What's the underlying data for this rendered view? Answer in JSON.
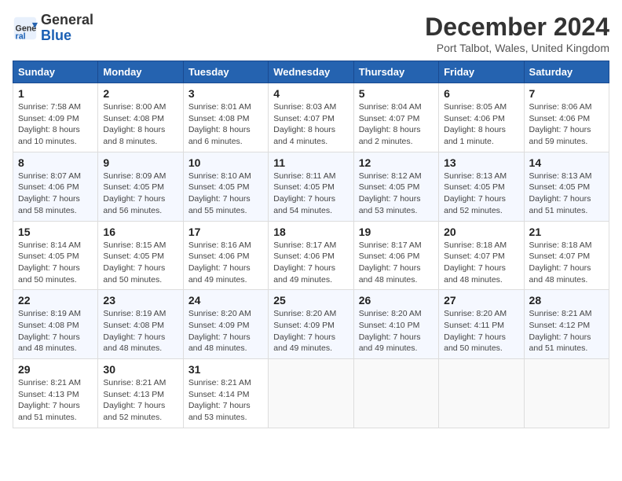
{
  "header": {
    "logo_line1": "General",
    "logo_line2": "Blue",
    "title": "December 2024",
    "location": "Port Talbot, Wales, United Kingdom"
  },
  "weekdays": [
    "Sunday",
    "Monday",
    "Tuesday",
    "Wednesday",
    "Thursday",
    "Friday",
    "Saturday"
  ],
  "weeks": [
    [
      {
        "day": "1",
        "sunrise": "Sunrise: 7:58 AM",
        "sunset": "Sunset: 4:09 PM",
        "daylight": "Daylight: 8 hours and 10 minutes."
      },
      {
        "day": "2",
        "sunrise": "Sunrise: 8:00 AM",
        "sunset": "Sunset: 4:08 PM",
        "daylight": "Daylight: 8 hours and 8 minutes."
      },
      {
        "day": "3",
        "sunrise": "Sunrise: 8:01 AM",
        "sunset": "Sunset: 4:08 PM",
        "daylight": "Daylight: 8 hours and 6 minutes."
      },
      {
        "day": "4",
        "sunrise": "Sunrise: 8:03 AM",
        "sunset": "Sunset: 4:07 PM",
        "daylight": "Daylight: 8 hours and 4 minutes."
      },
      {
        "day": "5",
        "sunrise": "Sunrise: 8:04 AM",
        "sunset": "Sunset: 4:07 PM",
        "daylight": "Daylight: 8 hours and 2 minutes."
      },
      {
        "day": "6",
        "sunrise": "Sunrise: 8:05 AM",
        "sunset": "Sunset: 4:06 PM",
        "daylight": "Daylight: 8 hours and 1 minute."
      },
      {
        "day": "7",
        "sunrise": "Sunrise: 8:06 AM",
        "sunset": "Sunset: 4:06 PM",
        "daylight": "Daylight: 7 hours and 59 minutes."
      }
    ],
    [
      {
        "day": "8",
        "sunrise": "Sunrise: 8:07 AM",
        "sunset": "Sunset: 4:06 PM",
        "daylight": "Daylight: 7 hours and 58 minutes."
      },
      {
        "day": "9",
        "sunrise": "Sunrise: 8:09 AM",
        "sunset": "Sunset: 4:05 PM",
        "daylight": "Daylight: 7 hours and 56 minutes."
      },
      {
        "day": "10",
        "sunrise": "Sunrise: 8:10 AM",
        "sunset": "Sunset: 4:05 PM",
        "daylight": "Daylight: 7 hours and 55 minutes."
      },
      {
        "day": "11",
        "sunrise": "Sunrise: 8:11 AM",
        "sunset": "Sunset: 4:05 PM",
        "daylight": "Daylight: 7 hours and 54 minutes."
      },
      {
        "day": "12",
        "sunrise": "Sunrise: 8:12 AM",
        "sunset": "Sunset: 4:05 PM",
        "daylight": "Daylight: 7 hours and 53 minutes."
      },
      {
        "day": "13",
        "sunrise": "Sunrise: 8:13 AM",
        "sunset": "Sunset: 4:05 PM",
        "daylight": "Daylight: 7 hours and 52 minutes."
      },
      {
        "day": "14",
        "sunrise": "Sunrise: 8:13 AM",
        "sunset": "Sunset: 4:05 PM",
        "daylight": "Daylight: 7 hours and 51 minutes."
      }
    ],
    [
      {
        "day": "15",
        "sunrise": "Sunrise: 8:14 AM",
        "sunset": "Sunset: 4:05 PM",
        "daylight": "Daylight: 7 hours and 50 minutes."
      },
      {
        "day": "16",
        "sunrise": "Sunrise: 8:15 AM",
        "sunset": "Sunset: 4:05 PM",
        "daylight": "Daylight: 7 hours and 50 minutes."
      },
      {
        "day": "17",
        "sunrise": "Sunrise: 8:16 AM",
        "sunset": "Sunset: 4:06 PM",
        "daylight": "Daylight: 7 hours and 49 minutes."
      },
      {
        "day": "18",
        "sunrise": "Sunrise: 8:17 AM",
        "sunset": "Sunset: 4:06 PM",
        "daylight": "Daylight: 7 hours and 49 minutes."
      },
      {
        "day": "19",
        "sunrise": "Sunrise: 8:17 AM",
        "sunset": "Sunset: 4:06 PM",
        "daylight": "Daylight: 7 hours and 48 minutes."
      },
      {
        "day": "20",
        "sunrise": "Sunrise: 8:18 AM",
        "sunset": "Sunset: 4:07 PM",
        "daylight": "Daylight: 7 hours and 48 minutes."
      },
      {
        "day": "21",
        "sunrise": "Sunrise: 8:18 AM",
        "sunset": "Sunset: 4:07 PM",
        "daylight": "Daylight: 7 hours and 48 minutes."
      }
    ],
    [
      {
        "day": "22",
        "sunrise": "Sunrise: 8:19 AM",
        "sunset": "Sunset: 4:08 PM",
        "daylight": "Daylight: 7 hours and 48 minutes."
      },
      {
        "day": "23",
        "sunrise": "Sunrise: 8:19 AM",
        "sunset": "Sunset: 4:08 PM",
        "daylight": "Daylight: 7 hours and 48 minutes."
      },
      {
        "day": "24",
        "sunrise": "Sunrise: 8:20 AM",
        "sunset": "Sunset: 4:09 PM",
        "daylight": "Daylight: 7 hours and 48 minutes."
      },
      {
        "day": "25",
        "sunrise": "Sunrise: 8:20 AM",
        "sunset": "Sunset: 4:09 PM",
        "daylight": "Daylight: 7 hours and 49 minutes."
      },
      {
        "day": "26",
        "sunrise": "Sunrise: 8:20 AM",
        "sunset": "Sunset: 4:10 PM",
        "daylight": "Daylight: 7 hours and 49 minutes."
      },
      {
        "day": "27",
        "sunrise": "Sunrise: 8:20 AM",
        "sunset": "Sunset: 4:11 PM",
        "daylight": "Daylight: 7 hours and 50 minutes."
      },
      {
        "day": "28",
        "sunrise": "Sunrise: 8:21 AM",
        "sunset": "Sunset: 4:12 PM",
        "daylight": "Daylight: 7 hours and 51 minutes."
      }
    ],
    [
      {
        "day": "29",
        "sunrise": "Sunrise: 8:21 AM",
        "sunset": "Sunset: 4:13 PM",
        "daylight": "Daylight: 7 hours and 51 minutes."
      },
      {
        "day": "30",
        "sunrise": "Sunrise: 8:21 AM",
        "sunset": "Sunset: 4:13 PM",
        "daylight": "Daylight: 7 hours and 52 minutes."
      },
      {
        "day": "31",
        "sunrise": "Sunrise: 8:21 AM",
        "sunset": "Sunset: 4:14 PM",
        "daylight": "Daylight: 7 hours and 53 minutes."
      },
      null,
      null,
      null,
      null
    ]
  ]
}
